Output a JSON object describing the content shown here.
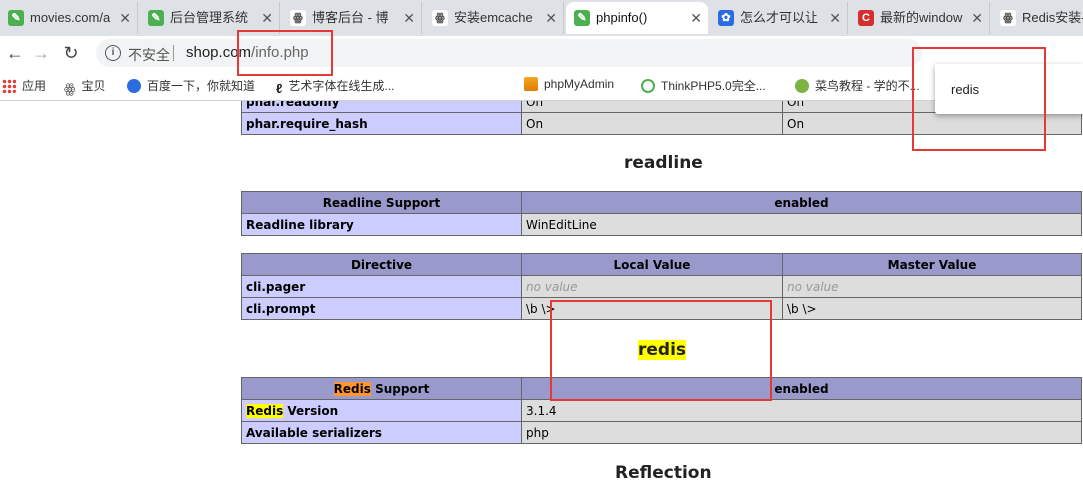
{
  "tabs": [
    {
      "title": "movies.com/a",
      "icon": "leaf-icon",
      "color": "#4caf50"
    },
    {
      "title": "后台管理系统",
      "icon": "leaf-icon",
      "color": "#4caf50"
    },
    {
      "title": "博客后台 - 博",
      "icon": "blog-icon",
      "color": "#555555"
    },
    {
      "title": "安装emcache",
      "icon": "blog-icon",
      "color": "#555555"
    },
    {
      "title": "phpinfo()",
      "icon": "leaf-icon",
      "color": "#4caf50"
    },
    {
      "title": "怎么才可以让",
      "icon": "paw-icon",
      "color": "#2b6de0"
    },
    {
      "title": "最新的window",
      "icon": "c-icon",
      "color": "#d32f2f"
    },
    {
      "title": "Redis安装-",
      "icon": "blog-icon",
      "color": "#555555"
    }
  ],
  "toolbar": {
    "back_icon": "←",
    "forward_icon": "→",
    "reload_icon": "↻",
    "info_glyph": "i",
    "security_text": "不安全",
    "url_host": "shop.com",
    "url_path": "/info.php"
  },
  "bookmarks": [
    {
      "label": "应用",
      "icon": "apps-grid-icon"
    },
    {
      "label": "宝贝",
      "icon": "blog-icon"
    },
    {
      "label": "百度一下，你就知道",
      "icon": "paw-icon"
    },
    {
      "label": "艺术字体在线生成...",
      "icon": "brush-icon"
    },
    {
      "label": "phpMyAdmin",
      "icon": "pma-icon"
    },
    {
      "label": "ThinkPHP5.0完全...",
      "icon": "think-icon"
    },
    {
      "label": "菜鸟教程 - 学的不...",
      "icon": "runoob-icon"
    }
  ],
  "find": {
    "query": "redis"
  },
  "phar_rows": [
    {
      "name": "phar.readonly",
      "local": "On",
      "master": "On"
    },
    {
      "name": "phar.require_hash",
      "local": "On",
      "master": "On"
    }
  ],
  "readline": {
    "title": "readline",
    "support_label": "Readline Support",
    "support_value": "enabled",
    "library_label": "Readline library",
    "library_value": "WinEditLine",
    "headers": [
      "Directive",
      "Local Value",
      "Master Value"
    ],
    "directives": [
      {
        "name": "cli.pager",
        "local": "no value",
        "master": "no value"
      },
      {
        "name": "cli.prompt",
        "local": "\\b \\>",
        "master": "\\b \\>"
      }
    ]
  },
  "redis": {
    "title": "redis",
    "support_word": "Redis",
    "support_rest": " Support",
    "support_value": "enabled",
    "version_word": "Redis",
    "version_rest": " Version",
    "version_value": "3.1.4",
    "serializers_label": "Available serializers",
    "serializers_value": "php"
  },
  "reflection": {
    "title": "Reflection"
  }
}
